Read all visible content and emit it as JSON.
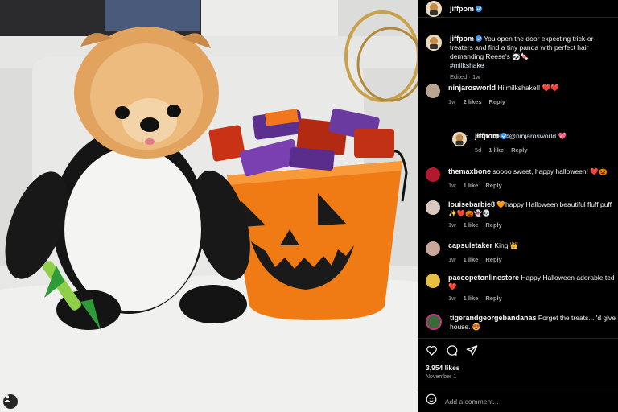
{
  "post": {
    "author": "jiffpom",
    "caption_prefix": "jiffpom",
    "caption": "You open the door expecting trick-or-treaters and find a tiny panda with perfect hair demanding Reese's 🐼🍬",
    "hashtag": "#milkshake",
    "edited": "Edited",
    "edited_time": "1w",
    "likes": "3,954 likes",
    "date": "November 1",
    "add_comment_placeholder": "Add a comment..."
  },
  "comments": [
    {
      "user": "ninjarosworld",
      "text": "Hi milkshake!! ❤️❤️",
      "time": "1w",
      "likes": "2 likes",
      "reply": "Reply",
      "avatar_color": "#b9a58f"
    },
    {
      "user": "jiffpom",
      "mention": "@ninjarosworld",
      "text": " 💖",
      "time": "5d",
      "likes": "1 like",
      "reply": "Reply",
      "avatar_color": "#e0d0b0"
    },
    {
      "user": "themaxbone",
      "text": "soooo sweet, happy halloween! ❤️🎃",
      "time": "1w",
      "likes": "1 like",
      "reply": "Reply",
      "avatar_color": "#b2192c"
    },
    {
      "user": "louisebarbie8",
      "text": "🧡happy Halloween beautiful fluff puff",
      "text2": "✨❤️🎃👻💀",
      "time": "1w",
      "likes": "1 like",
      "reply": "Reply",
      "avatar_color": "#d8c8c0"
    },
    {
      "user": "capsuletaker",
      "text": "King 👑",
      "time": "1w",
      "likes": "1 like",
      "reply": "Reply",
      "avatar_color": "#c9a89a"
    },
    {
      "user": "paccopetonlinestore",
      "text": "Happy Halloween adorable ted",
      "text2": "❤️",
      "time": "1w",
      "likes": "1 like",
      "reply": "Reply",
      "avatar_color": "#e8c040"
    },
    {
      "user": "tigerandgeorgebandanas",
      "text": "Forget the treats...I'd give",
      "text2": "house. 😍",
      "time": "",
      "likes": "",
      "reply": "",
      "avatar_color": "#3a6a3a"
    }
  ],
  "ui": {
    "hide_replies": "Hide replies",
    "accent": "#3897f0",
    "icons": [
      "heart-icon",
      "comment-icon",
      "share-icon",
      "emoji-icon",
      "tag-user-icon"
    ]
  }
}
